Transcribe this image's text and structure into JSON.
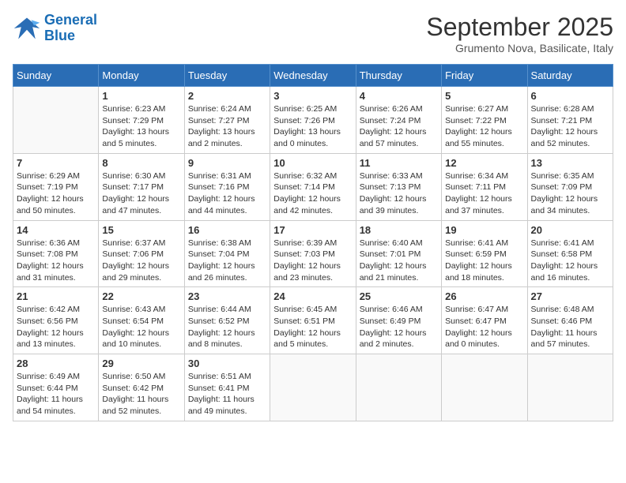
{
  "logo": {
    "line1": "General",
    "line2": "Blue"
  },
  "title": "September 2025",
  "subtitle": "Grumento Nova, Basilicate, Italy",
  "days_of_week": [
    "Sunday",
    "Monday",
    "Tuesday",
    "Wednesday",
    "Thursday",
    "Friday",
    "Saturday"
  ],
  "weeks": [
    [
      {
        "day": "",
        "info": ""
      },
      {
        "day": "1",
        "info": "Sunrise: 6:23 AM\nSunset: 7:29 PM\nDaylight: 13 hours\nand 5 minutes."
      },
      {
        "day": "2",
        "info": "Sunrise: 6:24 AM\nSunset: 7:27 PM\nDaylight: 13 hours\nand 2 minutes."
      },
      {
        "day": "3",
        "info": "Sunrise: 6:25 AM\nSunset: 7:26 PM\nDaylight: 13 hours\nand 0 minutes."
      },
      {
        "day": "4",
        "info": "Sunrise: 6:26 AM\nSunset: 7:24 PM\nDaylight: 12 hours\nand 57 minutes."
      },
      {
        "day": "5",
        "info": "Sunrise: 6:27 AM\nSunset: 7:22 PM\nDaylight: 12 hours\nand 55 minutes."
      },
      {
        "day": "6",
        "info": "Sunrise: 6:28 AM\nSunset: 7:21 PM\nDaylight: 12 hours\nand 52 minutes."
      }
    ],
    [
      {
        "day": "7",
        "info": "Sunrise: 6:29 AM\nSunset: 7:19 PM\nDaylight: 12 hours\nand 50 minutes."
      },
      {
        "day": "8",
        "info": "Sunrise: 6:30 AM\nSunset: 7:17 PM\nDaylight: 12 hours\nand 47 minutes."
      },
      {
        "day": "9",
        "info": "Sunrise: 6:31 AM\nSunset: 7:16 PM\nDaylight: 12 hours\nand 44 minutes."
      },
      {
        "day": "10",
        "info": "Sunrise: 6:32 AM\nSunset: 7:14 PM\nDaylight: 12 hours\nand 42 minutes."
      },
      {
        "day": "11",
        "info": "Sunrise: 6:33 AM\nSunset: 7:13 PM\nDaylight: 12 hours\nand 39 minutes."
      },
      {
        "day": "12",
        "info": "Sunrise: 6:34 AM\nSunset: 7:11 PM\nDaylight: 12 hours\nand 37 minutes."
      },
      {
        "day": "13",
        "info": "Sunrise: 6:35 AM\nSunset: 7:09 PM\nDaylight: 12 hours\nand 34 minutes."
      }
    ],
    [
      {
        "day": "14",
        "info": "Sunrise: 6:36 AM\nSunset: 7:08 PM\nDaylight: 12 hours\nand 31 minutes."
      },
      {
        "day": "15",
        "info": "Sunrise: 6:37 AM\nSunset: 7:06 PM\nDaylight: 12 hours\nand 29 minutes."
      },
      {
        "day": "16",
        "info": "Sunrise: 6:38 AM\nSunset: 7:04 PM\nDaylight: 12 hours\nand 26 minutes."
      },
      {
        "day": "17",
        "info": "Sunrise: 6:39 AM\nSunset: 7:03 PM\nDaylight: 12 hours\nand 23 minutes."
      },
      {
        "day": "18",
        "info": "Sunrise: 6:40 AM\nSunset: 7:01 PM\nDaylight: 12 hours\nand 21 minutes."
      },
      {
        "day": "19",
        "info": "Sunrise: 6:41 AM\nSunset: 6:59 PM\nDaylight: 12 hours\nand 18 minutes."
      },
      {
        "day": "20",
        "info": "Sunrise: 6:41 AM\nSunset: 6:58 PM\nDaylight: 12 hours\nand 16 minutes."
      }
    ],
    [
      {
        "day": "21",
        "info": "Sunrise: 6:42 AM\nSunset: 6:56 PM\nDaylight: 12 hours\nand 13 minutes."
      },
      {
        "day": "22",
        "info": "Sunrise: 6:43 AM\nSunset: 6:54 PM\nDaylight: 12 hours\nand 10 minutes."
      },
      {
        "day": "23",
        "info": "Sunrise: 6:44 AM\nSunset: 6:52 PM\nDaylight: 12 hours\nand 8 minutes."
      },
      {
        "day": "24",
        "info": "Sunrise: 6:45 AM\nSunset: 6:51 PM\nDaylight: 12 hours\nand 5 minutes."
      },
      {
        "day": "25",
        "info": "Sunrise: 6:46 AM\nSunset: 6:49 PM\nDaylight: 12 hours\nand 2 minutes."
      },
      {
        "day": "26",
        "info": "Sunrise: 6:47 AM\nSunset: 6:47 PM\nDaylight: 12 hours\nand 0 minutes."
      },
      {
        "day": "27",
        "info": "Sunrise: 6:48 AM\nSunset: 6:46 PM\nDaylight: 11 hours\nand 57 minutes."
      }
    ],
    [
      {
        "day": "28",
        "info": "Sunrise: 6:49 AM\nSunset: 6:44 PM\nDaylight: 11 hours\nand 54 minutes."
      },
      {
        "day": "29",
        "info": "Sunrise: 6:50 AM\nSunset: 6:42 PM\nDaylight: 11 hours\nand 52 minutes."
      },
      {
        "day": "30",
        "info": "Sunrise: 6:51 AM\nSunset: 6:41 PM\nDaylight: 11 hours\nand 49 minutes."
      },
      {
        "day": "",
        "info": ""
      },
      {
        "day": "",
        "info": ""
      },
      {
        "day": "",
        "info": ""
      },
      {
        "day": "",
        "info": ""
      }
    ]
  ]
}
